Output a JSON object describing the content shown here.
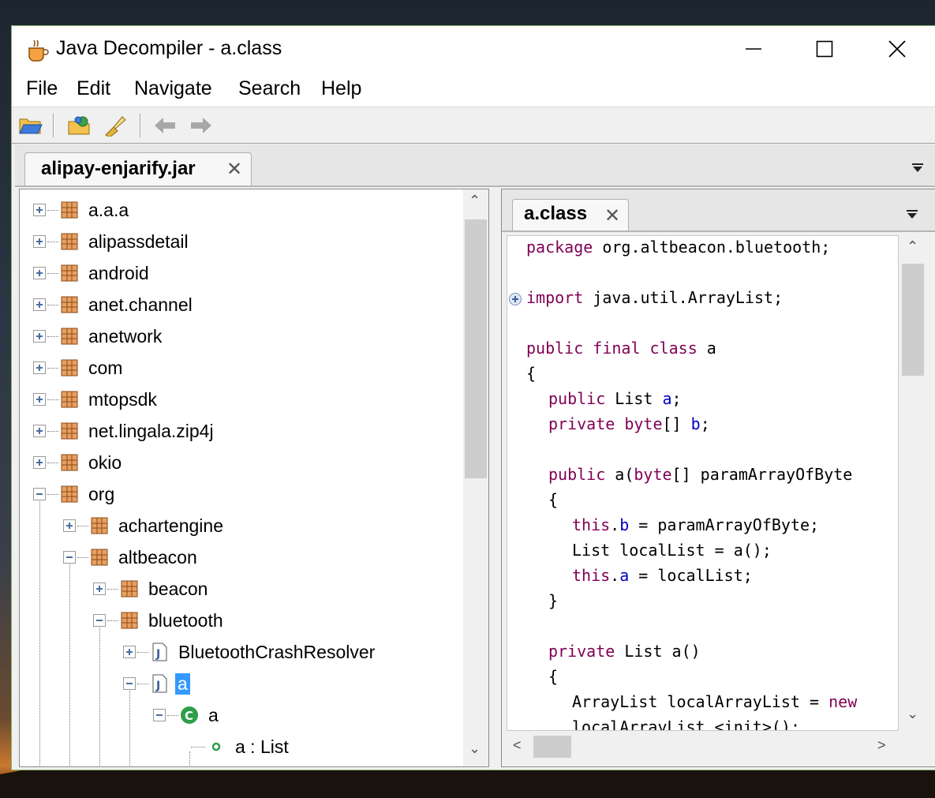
{
  "window": {
    "title": "Java Decompiler - a.class",
    "minimize_symbol": "—",
    "maximize_symbol": "☐",
    "close_symbol": "✕"
  },
  "menu": [
    "File",
    "Edit",
    "Navigate",
    "Search",
    "Help"
  ],
  "toolbar": {
    "icons": [
      "open-file-icon",
      "open-type-icon",
      "search-tool-icon",
      "back-arrow-icon",
      "forward-arrow-icon"
    ]
  },
  "outer_tab": {
    "label": "alipay-enjarify.jar",
    "close": "✕"
  },
  "tree": {
    "items": [
      {
        "label": "a.a.a"
      },
      {
        "label": "alipassdetail"
      },
      {
        "label": "android"
      },
      {
        "label": "anet.channel"
      },
      {
        "label": "anetwork"
      },
      {
        "label": "com"
      },
      {
        "label": "mtopsdk"
      },
      {
        "label": "net.lingala.zip4j"
      },
      {
        "label": "okio"
      },
      {
        "label": "org"
      },
      {
        "label": "achartengine"
      },
      {
        "label": "altbeacon"
      },
      {
        "label": "beacon"
      },
      {
        "label": "bluetooth"
      },
      {
        "label": "BluetoothCrashResolver"
      },
      {
        "label": "a"
      },
      {
        "label": "a"
      },
      {
        "label": "a : List"
      }
    ]
  },
  "editor_tab": {
    "label": "a.class",
    "close": "✕"
  },
  "code": {
    "l1_kw": "package",
    "l1_rest": " org.altbeacon.bluetooth;",
    "l3_kw": "import",
    "l3_rest": " java.util.ArrayList;",
    "l5_kw": "public final class",
    "l5_rest": " a",
    "l6": "{",
    "l7_kw": "public",
    "l7_mid": " List ",
    "l7_fld": "a",
    "l7_end": ";",
    "l8_kw1": "private",
    "l8_sp": " ",
    "l8_kw2": "byte",
    "l8_mid": "[] ",
    "l8_fld": "b",
    "l8_end": ";",
    "l10_kw": "public",
    "l10_mid": " a(",
    "l10_kw2": "byte",
    "l10_rest": "[] paramArrayOfByte",
    "l11": "{",
    "l12_kw": "this",
    "l12_dot": ".",
    "l12_fld": "b",
    "l12_rest": " = paramArrayOfByte;",
    "l13": "List localList = a();",
    "l14_kw": "this",
    "l14_dot": ".",
    "l14_fld": "a",
    "l14_rest": " = localList;",
    "l15": "}",
    "l17_kw": "private",
    "l17_rest": " List a()",
    "l18": "{",
    "l19_a": "ArrayList localArrayList = ",
    "l19_kw": "new",
    "l20": "localArrayList.<init>();"
  },
  "scroll": {
    "up": "⌃",
    "down": "⌄",
    "left": "<",
    "right": ">"
  }
}
